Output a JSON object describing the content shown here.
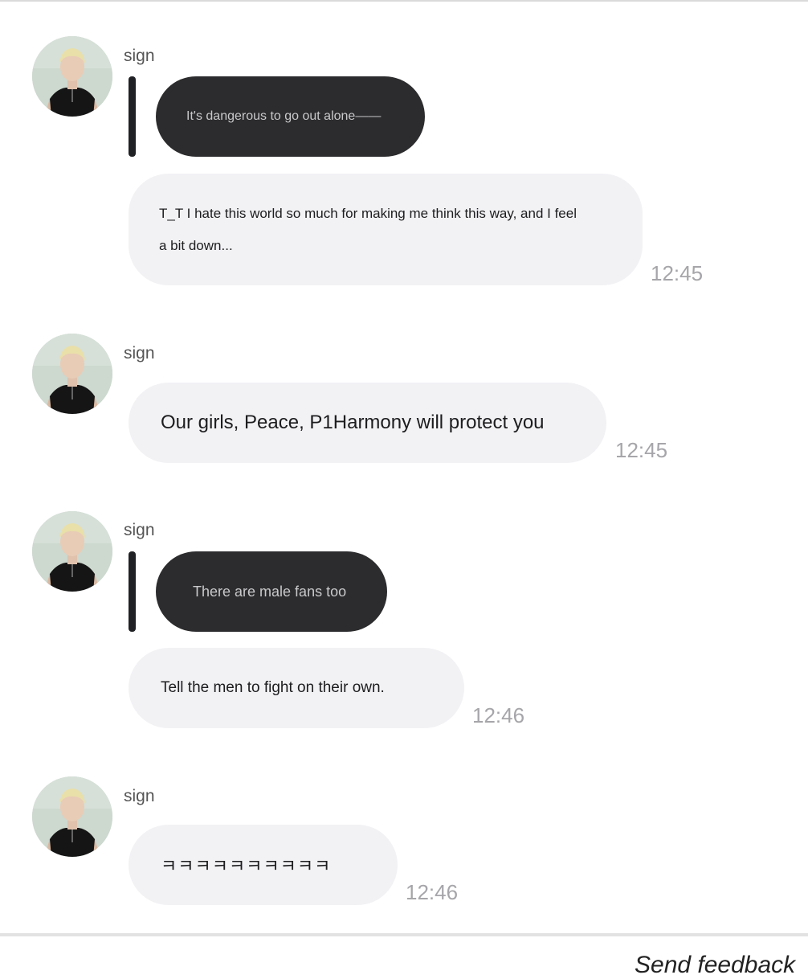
{
  "messages": [
    {
      "sender": "sign",
      "quote": "It's dangerous to go out alone——",
      "text_line1": "T_T I hate this world so much for making me think this way, and I feel",
      "text_line2": "a bit down...",
      "time": "12:45"
    },
    {
      "sender": "sign",
      "text": "Our girls, Peace, P1Harmony will protect you",
      "time": "12:45"
    },
    {
      "sender": "sign",
      "quote": "There are male fans too",
      "text": "Tell the men to fight on their own.",
      "time": "12:46"
    },
    {
      "sender": "sign",
      "text": "ㅋㅋㅋㅋㅋㅋㅋㅋㅋㅋ",
      "time": "12:46"
    }
  ],
  "footer": {
    "label": "Send feedback"
  }
}
